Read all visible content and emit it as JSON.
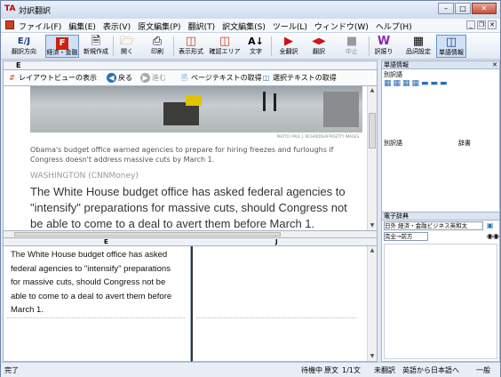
{
  "window": {
    "title": "対訳翻訳",
    "app_icon": "TA"
  },
  "menu": [
    "ファイル(F)",
    "編集(E)",
    "表示(V)",
    "原文編集(P)",
    "翻訳(T)",
    "訳文編集(S)",
    "ツール(L)",
    "ウィンドウ(W)",
    "ヘルプ(H)"
  ],
  "toolbar": {
    "direction": "翻訳方向",
    "direction_icon": "E/J",
    "field": "経済・金融",
    "new": "新規作成",
    "open": "開く",
    "print": "印刷",
    "display": "表示形式",
    "confirm_area": "確認エリア",
    "char": "文字",
    "translate_all": "全翻訳",
    "translate": "翻訳",
    "stop": "中止",
    "dict_lookup": "訳振り",
    "quality": "品詞設定",
    "word_info": "単語情報"
  },
  "doc": {
    "tab_label": "E"
  },
  "webbar": {
    "layout_view": "レイアウトビューの表示",
    "back": "戻る",
    "forward": "進む",
    "get_page_text": "ページテキストの取得",
    "get_selected_text": "選択テキストの取得"
  },
  "article": {
    "photo_credit": "PHOTO: PAUL J. RICHARDS/AFP/GETTY IMAGES",
    "caption": "Obama's budget office warned agencies to prepare for hiring freezes and furloughs if Congress doesn't address massive cuts by March 1.",
    "byline": "WASHINGTON (CNNMoney)",
    "headline": "The White House budget office has asked federal agencies to \"intensify\" preparations for massive cuts, should Congress not be able to come to a deal to avert them before March 1."
  },
  "panes": {
    "source_label": "E",
    "target_label": "J",
    "source_text": "The White House budget office has asked federal agencies to \"intensify\" preparations for massive cuts, should Congress not be able to come to a deal to avert them before March 1."
  },
  "right_panel": {
    "word_info_title": "単語情報",
    "alt_words_label": "別訳語",
    "alt_word_col": "別訳語",
    "dict_col": "辞書",
    "dictionary_title": "電子辞典",
    "dictionary_select": "日外 経済・金融ビジネス英和太",
    "match_select": "完全→前方"
  },
  "status": {
    "left": "完了",
    "state": "待機中",
    "text_type": "原文",
    "page": "1/1文",
    "translated": "未翻訳",
    "direction": "英語から日本語へ",
    "mode": "一般"
  },
  "colors": {
    "accent": "#c00000",
    "link_blue": "#2a6ebb"
  }
}
